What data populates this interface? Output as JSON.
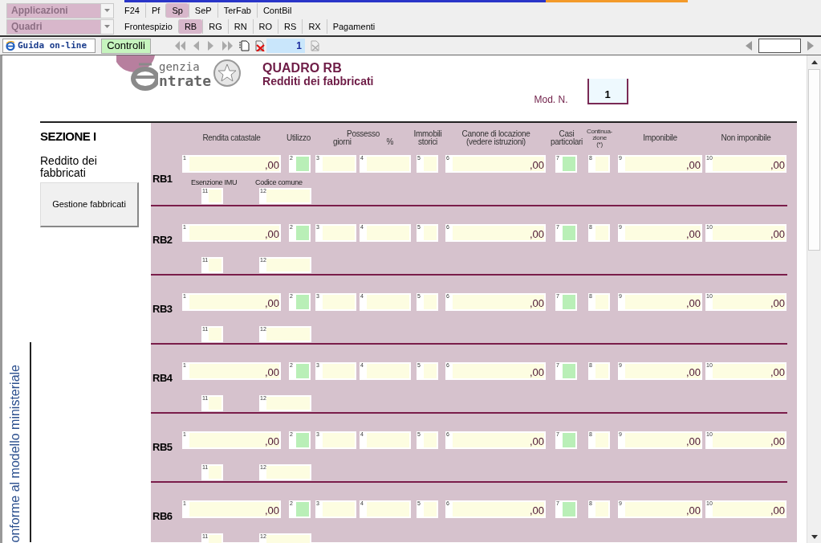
{
  "menus": [
    {
      "label": "Applicazioni",
      "tabs": [
        {
          "label": "F24",
          "selected": false
        },
        {
          "label": "Pf",
          "selected": false
        },
        {
          "label": "Sp",
          "selected": true
        },
        {
          "label": "SeP",
          "selected": false
        },
        {
          "label": "TerFab",
          "selected": false
        },
        {
          "label": "ContBil",
          "selected": false
        }
      ]
    },
    {
      "label": "Quadri",
      "tabs": [
        {
          "label": "Frontespizio",
          "selected": false
        },
        {
          "label": "RB",
          "selected": true
        },
        {
          "label": "RG",
          "selected": false
        },
        {
          "label": "RN",
          "selected": false
        },
        {
          "label": "RO",
          "selected": false
        },
        {
          "label": "RS",
          "selected": false
        },
        {
          "label": "RX",
          "selected": false
        },
        {
          "label": "Pagamenti",
          "selected": false
        }
      ]
    }
  ],
  "toolbar": {
    "help_button": "Guida on-line",
    "check_button": "Controlli",
    "page_field": "1"
  },
  "header": {
    "logo_top": "genzia",
    "logo_bottom": "ntrate",
    "title": "QUADRO RB",
    "subtitle": "Redditi dei fabbricati",
    "mod_label": "Mod. N.",
    "mod_value": "1"
  },
  "section": {
    "title": "SEZIONE I",
    "description": "Reddito dei fabbricati",
    "button": "Gestione fabbricati"
  },
  "side_note": "onforme al modello ministeriale",
  "columns": [
    {
      "lines": [
        "Rendita catastale"
      ]
    },
    {
      "lines": [
        "Utilizzo"
      ]
    },
    {
      "lines": [
        "Possesso"
      ],
      "sub": [
        "giorni",
        "%"
      ]
    },
    {
      "lines": [
        "Immobili",
        "storici"
      ]
    },
    {
      "lines": [
        "Canone di locazione",
        "(vedere istruzioni)"
      ]
    },
    {
      "lines": [
        "Casi",
        "particolari"
      ]
    },
    {
      "lines": [
        "Continua-",
        "zione",
        "(*)"
      ]
    },
    {
      "lines": [
        "Imponibile"
      ]
    },
    {
      "lines": [
        "Non imponibile"
      ]
    }
  ],
  "rows": [
    {
      "label": "RB1",
      "sublabels": [
        "Esenzione IMU",
        "Codice comune"
      ],
      "fields": [
        {
          "n": "1",
          "kind": "amount",
          "value": ",00"
        },
        {
          "n": "2",
          "kind": "flag"
        },
        {
          "n": "3",
          "kind": "text"
        },
        {
          "n": "4",
          "kind": "text"
        },
        {
          "n": "5",
          "kind": "text"
        },
        {
          "n": "6",
          "kind": "amount",
          "value": ",00"
        },
        {
          "n": "7",
          "kind": "flag"
        },
        {
          "n": "8",
          "kind": "text"
        },
        {
          "n": "9",
          "kind": "amount",
          "value": ",00"
        },
        {
          "n": "10",
          "kind": "amount",
          "value": ",00"
        },
        {
          "n": "11",
          "kind": "text"
        },
        {
          "n": "12",
          "kind": "text"
        }
      ]
    },
    {
      "label": "RB2",
      "fields": [
        {
          "n": "1",
          "kind": "amount",
          "value": ",00"
        },
        {
          "n": "2",
          "kind": "flag"
        },
        {
          "n": "3",
          "kind": "text"
        },
        {
          "n": "4",
          "kind": "text"
        },
        {
          "n": "5",
          "kind": "text"
        },
        {
          "n": "6",
          "kind": "amount",
          "value": ",00"
        },
        {
          "n": "7",
          "kind": "flag"
        },
        {
          "n": "8",
          "kind": "text"
        },
        {
          "n": "9",
          "kind": "amount",
          "value": ",00"
        },
        {
          "n": "10",
          "kind": "amount",
          "value": ",00"
        },
        {
          "n": "11",
          "kind": "text"
        },
        {
          "n": "12",
          "kind": "text"
        }
      ]
    },
    {
      "label": "RB3",
      "fields": [
        {
          "n": "1",
          "kind": "amount",
          "value": ",00"
        },
        {
          "n": "2",
          "kind": "flag"
        },
        {
          "n": "3",
          "kind": "text"
        },
        {
          "n": "4",
          "kind": "text"
        },
        {
          "n": "5",
          "kind": "text"
        },
        {
          "n": "6",
          "kind": "amount",
          "value": ",00"
        },
        {
          "n": "7",
          "kind": "flag"
        },
        {
          "n": "8",
          "kind": "text"
        },
        {
          "n": "9",
          "kind": "amount",
          "value": ",00"
        },
        {
          "n": "10",
          "kind": "amount",
          "value": ",00"
        },
        {
          "n": "11",
          "kind": "text"
        },
        {
          "n": "12",
          "kind": "text"
        }
      ]
    },
    {
      "label": "RB4",
      "fields": [
        {
          "n": "1",
          "kind": "amount",
          "value": ",00"
        },
        {
          "n": "2",
          "kind": "flag"
        },
        {
          "n": "3",
          "kind": "text"
        },
        {
          "n": "4",
          "kind": "text"
        },
        {
          "n": "5",
          "kind": "text"
        },
        {
          "n": "6",
          "kind": "amount",
          "value": ",00"
        },
        {
          "n": "7",
          "kind": "flag"
        },
        {
          "n": "8",
          "kind": "text"
        },
        {
          "n": "9",
          "kind": "amount",
          "value": ",00"
        },
        {
          "n": "10",
          "kind": "amount",
          "value": ",00"
        },
        {
          "n": "11",
          "kind": "text"
        },
        {
          "n": "12",
          "kind": "text"
        }
      ]
    },
    {
      "label": "RB5",
      "fields": [
        {
          "n": "1",
          "kind": "amount",
          "value": ",00"
        },
        {
          "n": "2",
          "kind": "flag"
        },
        {
          "n": "3",
          "kind": "text"
        },
        {
          "n": "4",
          "kind": "text"
        },
        {
          "n": "5",
          "kind": "text"
        },
        {
          "n": "6",
          "kind": "amount",
          "value": ",00"
        },
        {
          "n": "7",
          "kind": "flag"
        },
        {
          "n": "8",
          "kind": "text"
        },
        {
          "n": "9",
          "kind": "amount",
          "value": ",00"
        },
        {
          "n": "10",
          "kind": "amount",
          "value": ",00"
        },
        {
          "n": "11",
          "kind": "text"
        },
        {
          "n": "12",
          "kind": "text"
        }
      ]
    },
    {
      "label": "RB6",
      "fields": [
        {
          "n": "1",
          "kind": "amount",
          "value": ",00"
        },
        {
          "n": "2",
          "kind": "flag"
        },
        {
          "n": "3",
          "kind": "text"
        },
        {
          "n": "4",
          "kind": "text"
        },
        {
          "n": "5",
          "kind": "text"
        },
        {
          "n": "6",
          "kind": "amount",
          "value": ",00"
        },
        {
          "n": "7",
          "kind": "flag"
        },
        {
          "n": "8",
          "kind": "text"
        },
        {
          "n": "9",
          "kind": "amount",
          "value": ",00"
        },
        {
          "n": "10",
          "kind": "amount",
          "value": ",00"
        },
        {
          "n": "11",
          "kind": "text"
        },
        {
          "n": "12",
          "kind": "text"
        }
      ]
    }
  ]
}
